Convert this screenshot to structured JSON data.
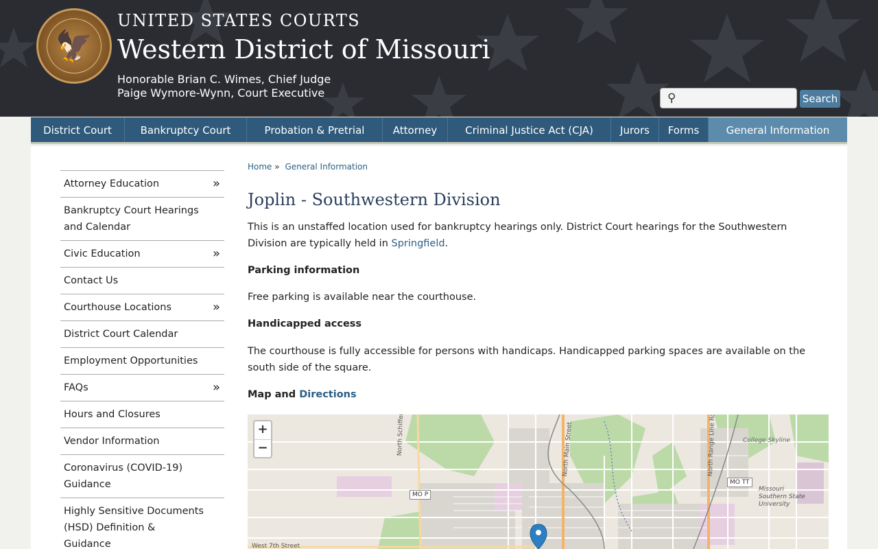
{
  "header": {
    "top_title": "UNITED STATES COURTS",
    "main_title": "Western District of Missouri",
    "chief_judge": "Honorable Brian C. Wimes, Chief Judge",
    "executive": "Paige Wymore-Wynn, Court Executive",
    "search_placeholder": "",
    "search_button": "Search"
  },
  "nav": [
    {
      "label": "District Court"
    },
    {
      "label": "Bankruptcy Court"
    },
    {
      "label": "Probation & Pretrial"
    },
    {
      "label": "Attorney"
    },
    {
      "label": "Criminal Justice Act (CJA)"
    },
    {
      "label": "Jurors"
    },
    {
      "label": "Forms"
    },
    {
      "label": "General Information",
      "active": true
    }
  ],
  "sidebar": [
    {
      "label": "Attorney Education",
      "arrow": "»"
    },
    {
      "label": "Bankruptcy Court Hearings and Calendar"
    },
    {
      "label": "Civic Education",
      "arrow": "»"
    },
    {
      "label": "Contact Us"
    },
    {
      "label": "Courthouse Locations",
      "arrow": "»"
    },
    {
      "label": "District Court Calendar"
    },
    {
      "label": "Employment Opportunities"
    },
    {
      "label": "FAQs",
      "arrow": "»"
    },
    {
      "label": "Hours and Closures"
    },
    {
      "label": "Vendor Information"
    },
    {
      "label": "Coronavirus (COVID-19) Guidance"
    },
    {
      "label": "Highly Sensitive Documents (HSD) Definition & Guidance"
    }
  ],
  "breadcrumb": {
    "home": "Home",
    "sep": "»",
    "current": "General Information"
  },
  "page": {
    "title": "Joplin - Southwestern Division",
    "intro_text": "This is an unstaffed location used for bankruptcy hearings only. District Court hearings for the Southwestern Division are typically held in",
    "intro_link": "Springfield",
    "intro_end": ".",
    "parking_heading": "Parking information",
    "parking_text": "Free parking is available near the courthouse.",
    "access_heading": "Handicapped access",
    "access_text": "The courthouse is fully accessible for persons with handicaps. Handicapped parking spaces are available on the south side of the square.",
    "map_heading": "Map and",
    "map_link": "Directions"
  },
  "map": {
    "zoom_in": "+",
    "zoom_out": "−",
    "labels": {
      "schifferdecker": "North Schifferdecker Ave",
      "main_street": "North Main Street",
      "range_line": "North Range Line Road",
      "college_skyline": "College Skyline",
      "mssu": "Missouri Southern State University",
      "west_7th": "West 7th Street",
      "mo_p": "MO P",
      "mo_tt": "MO TT"
    }
  },
  "colors": {
    "header_bg": "#2a2c31",
    "nav_bg": "#2f5a7b",
    "nav_active": "#5d8bab",
    "link": "#2a5f84",
    "title": "#2a3e5c"
  }
}
